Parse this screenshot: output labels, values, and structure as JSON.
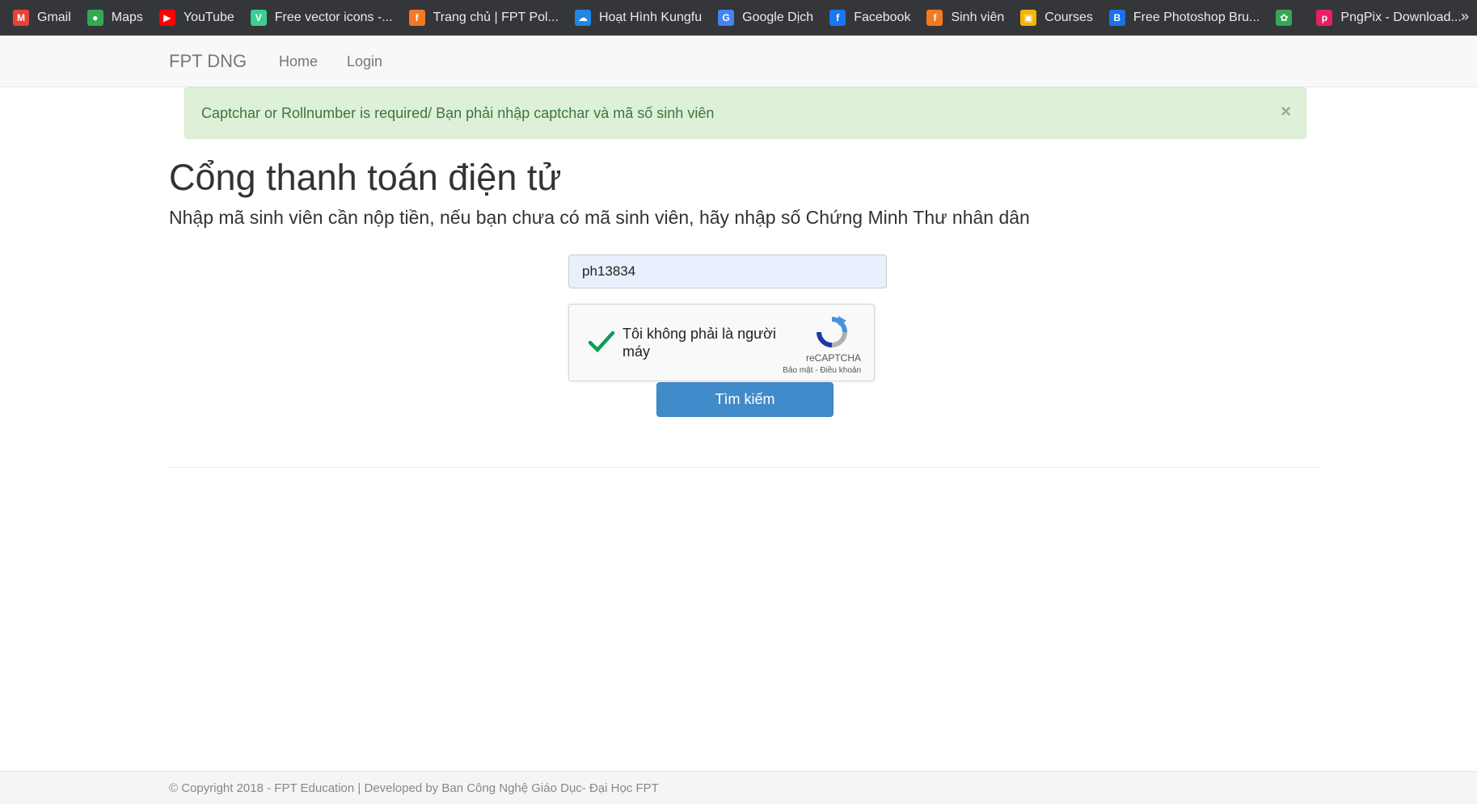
{
  "bookmarks": [
    {
      "label": "Gmail",
      "icon": "gmail-icon",
      "color": "#ea4335",
      "glyph": "M"
    },
    {
      "label": "Maps",
      "icon": "maps-pin-icon",
      "color": "#34a853",
      "glyph": "●"
    },
    {
      "label": "YouTube",
      "icon": "youtube-icon",
      "color": "#ff0000",
      "glyph": "▶"
    },
    {
      "label": "Free vector icons -...",
      "icon": "flaticon-icon",
      "color": "#3ccf91",
      "glyph": "V"
    },
    {
      "label": "Trang chủ | FPT Pol...",
      "icon": "fpt-icon",
      "color": "#f47920",
      "glyph": "f"
    },
    {
      "label": "Hoạt Hình Kungfu",
      "icon": "cloud-icon",
      "color": "#1e88e5",
      "glyph": "☁"
    },
    {
      "label": "Google Dịch",
      "icon": "google-translate-icon",
      "color": "#4285f4",
      "glyph": "G"
    },
    {
      "label": "Facebook",
      "icon": "facebook-icon",
      "color": "#1877f2",
      "glyph": "f"
    },
    {
      "label": "Sinh viên",
      "icon": "fpt-icon",
      "color": "#f47920",
      "glyph": "f"
    },
    {
      "label": "Courses",
      "icon": "courses-icon",
      "color": "#f4b400",
      "glyph": "▣"
    },
    {
      "label": "Free Photoshop Bru...",
      "icon": "brusheezy-icon",
      "color": "#1a73e8",
      "glyph": "B"
    },
    {
      "label": "",
      "icon": "google-ecosystem-icon",
      "color": "#34a853",
      "glyph": "✿"
    },
    {
      "label": "PngPix - Download...",
      "icon": "pngpix-icon",
      "color": "#e91e63",
      "glyph": "p"
    }
  ],
  "bookmarks_more": "»",
  "navbar": {
    "brand": "FPT DNG",
    "links": [
      "Home",
      "Login"
    ]
  },
  "alert": {
    "message": "Captchar or Rollnumber is required/ Bạn phải nhập captchar và mã số sinh viên",
    "close": "×"
  },
  "page": {
    "title": "Cổng thanh toán điện tử",
    "subtitle": "Nhập mã sinh viên cần nộp tiền, nếu bạn chưa có mã sinh viên, hãy nhập số Chứng Minh Thư nhân dân"
  },
  "form": {
    "roll_value": "ph13834",
    "captcha_label": "Tôi không phải là người máy",
    "captcha_brand": "reCAPTCHA",
    "captcha_links": "Bảo mật - Điều khoản",
    "search_label": "Tìm kiếm"
  },
  "footer": {
    "text": "© Copyright 2018 - FPT Education | Developed by Ban Công Nghệ Giáo Dục- Đại Học FPT"
  },
  "colors": {
    "alert_bg": "#dff0d8",
    "alert_text": "#3c763d",
    "button": "#428bca",
    "input_bg": "#e8f0fe",
    "check": "#0f9d58"
  }
}
